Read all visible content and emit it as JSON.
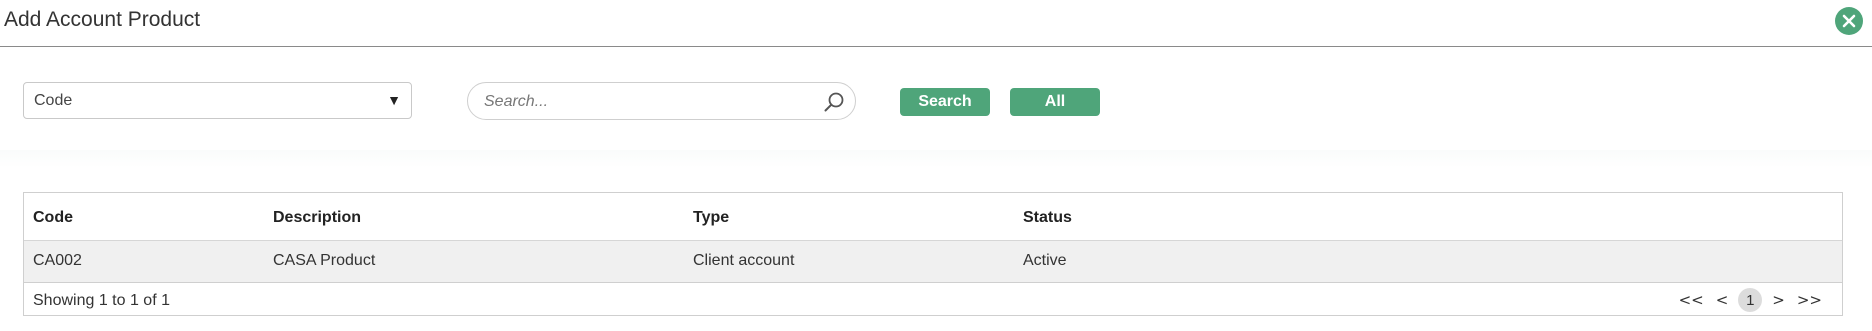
{
  "header": {
    "title": "Add Account Product",
    "close_icon": "close-icon",
    "accent_color": "#4fa57a"
  },
  "filter": {
    "field_select": {
      "selected": "Code"
    },
    "search": {
      "placeholder": "Search...",
      "value": ""
    },
    "search_button_label": "Search",
    "all_button_label": "All"
  },
  "table": {
    "columns": [
      "Code",
      "Description",
      "Type",
      "Status"
    ],
    "rows": [
      {
        "code": "CA002",
        "description": "CASA Product",
        "type": "Client account",
        "status": "Active"
      }
    ],
    "footer": {
      "showing": "Showing 1 to 1 of 1",
      "pager": {
        "first": "<<",
        "prev": "<",
        "current": "1",
        "next": ">",
        "last": ">>"
      }
    }
  }
}
